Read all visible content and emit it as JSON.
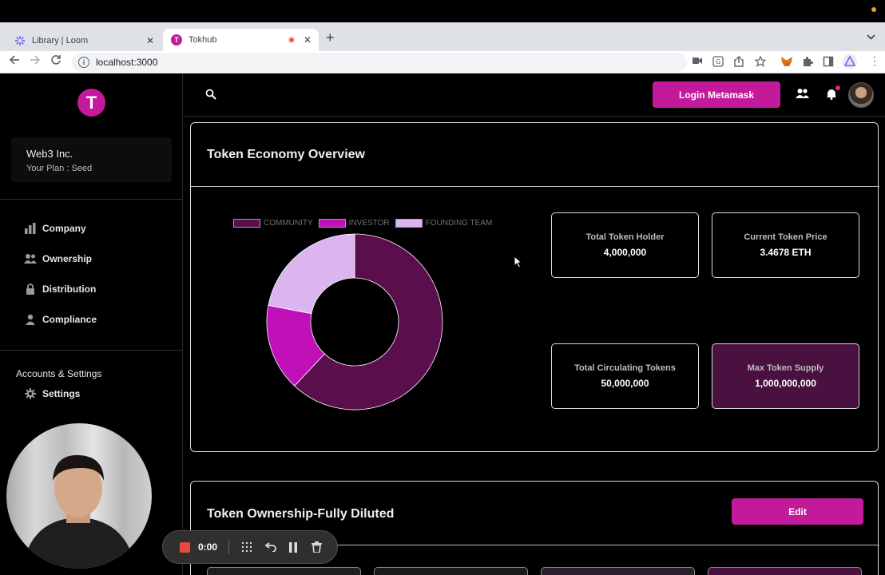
{
  "browser": {
    "tabs": [
      {
        "title": "Library | Loom",
        "favicon_color": "#625df5"
      },
      {
        "title": "Tokhub",
        "favicon": "T",
        "favicon_color": "#c21a9b",
        "recording": true
      }
    ],
    "url": "localhost:3000"
  },
  "sidebar": {
    "logo_letter": "T",
    "org_name": "Web3 Inc.",
    "plan": "Your Plan : Seed",
    "nav": [
      {
        "label": "Company",
        "icon": "bar-chart-icon"
      },
      {
        "label": "Ownership",
        "icon": "people-icon"
      },
      {
        "label": "Distribution",
        "icon": "lock-icon"
      },
      {
        "label": "Compliance",
        "icon": "person-icon"
      }
    ],
    "accounts_heading": "Accounts & Settings",
    "settings_label": "Settings"
  },
  "header": {
    "login_label": "Login Metamask"
  },
  "overview": {
    "title": "Token Economy Overview",
    "legend": [
      {
        "label": "COMMUNITY",
        "color": "#5a0f4c"
      },
      {
        "label": "INVESTOR",
        "color": "#c010b8"
      },
      {
        "label": "FOUNDING TEAM",
        "color": "#dcb4f0"
      }
    ],
    "donut": [
      {
        "label": "COMMUNITY",
        "fraction": 0.62,
        "color": "#5a0f4c"
      },
      {
        "label": "INVESTOR",
        "fraction": 0.16,
        "color": "#c010b8"
      },
      {
        "label": "FOUNDING TEAM",
        "fraction": 0.22,
        "color": "#dcb4f0"
      }
    ],
    "stats": [
      {
        "label": "Total Token Holder",
        "value": "4,000,000"
      },
      {
        "label": "Current Token Price",
        "value": "3.4678 ETH"
      },
      {
        "label": "Total Circulating Tokens",
        "value": "50,000,000"
      },
      {
        "label": "Max Token Supply",
        "value": "1,000,000,000"
      }
    ]
  },
  "ownership": {
    "title": "Token Ownership-Fully Diluted",
    "edit_label": "Edit"
  },
  "loom": {
    "timer": "0:00"
  },
  "colors": {
    "accent": "#c21a9b",
    "highlight_card": "#4a1040"
  }
}
